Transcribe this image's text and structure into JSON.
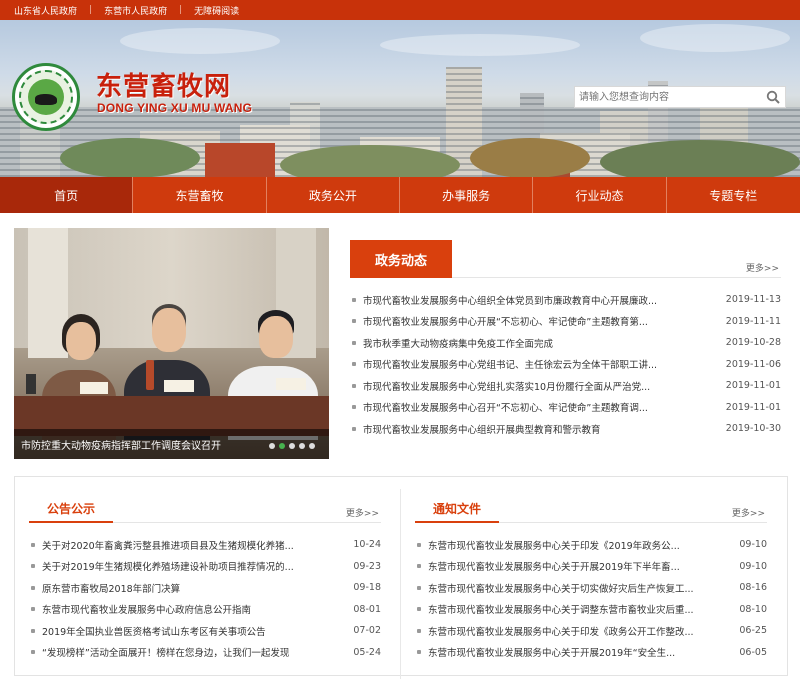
{
  "topbar": {
    "links": [
      "山东省人民政府",
      "东营市人民政府",
      "无障碍阅读"
    ],
    "separator": "|"
  },
  "header": {
    "site_title": "东营畜牧网",
    "site_subtitle": "DONG YING XU MU WANG",
    "search_placeholder": "请输入您想查询内容"
  },
  "nav": {
    "items": [
      "首页",
      "东营畜牧",
      "政务公开",
      "办事服务",
      "行业动态",
      "专题专栏"
    ],
    "active_index": 0
  },
  "slider": {
    "caption": "市防控重大动物疫病指挥部工作调度会议召开",
    "dot_count": 5,
    "active_dot": 1
  },
  "news": {
    "title": "政务动态",
    "more": "更多>>",
    "items": [
      {
        "title": "市现代畜牧业发展服务中心组织全体党员到市廉政教育中心开展廉政...",
        "date": "2019-11-13"
      },
      {
        "title": "市现代畜牧业发展服务中心开展“不忘初心、牢记使命”主题教育第...",
        "date": "2019-11-11"
      },
      {
        "title": "我市秋季重大动物疫病集中免疫工作全面完成",
        "date": "2019-10-28"
      },
      {
        "title": "市现代畜牧业发展服务中心党组书记、主任徐宏云为全体干部职工讲...",
        "date": "2019-11-06"
      },
      {
        "title": "市现代畜牧业发展服务中心党组扎实落实10月份履行全面从严治党...",
        "date": "2019-11-01"
      },
      {
        "title": "市现代畜牧业发展服务中心召开“不忘初心、牢记使命”主题教育调...",
        "date": "2019-11-01"
      },
      {
        "title": "市现代畜牧业发展服务中心组织开展典型教育和警示教育",
        "date": "2019-10-30"
      }
    ]
  },
  "notice": {
    "title": "公告公示",
    "more": "更多>>",
    "items": [
      {
        "title": "关于对2020年畜禽粪污整县推进项目县及生猪规模化养猪...",
        "date": "10-24"
      },
      {
        "title": "关于对2019年生猪规模化养殖场建设补助项目推荐情况的...",
        "date": "09-23"
      },
      {
        "title": "原东营市畜牧局2018年部门决算",
        "date": "09-18"
      },
      {
        "title": "东营市现代畜牧业发展服务中心政府信息公开指南",
        "date": "08-01"
      },
      {
        "title": "2019年全国执业兽医资格考试山东考区有关事项公告",
        "date": "07-02"
      },
      {
        "title": "“发现榜样”活动全面展开！榜样在您身边，让我们一起发现",
        "date": "05-24"
      }
    ]
  },
  "docs": {
    "title": "通知文件",
    "more": "更多>>",
    "items": [
      {
        "title": "东营市现代畜牧业发展服务中心关于印发《2019年政务公...",
        "date": "09-10"
      },
      {
        "title": "东营市现代畜牧业发展服务中心关于开展2019年下半年畜...",
        "date": "09-10"
      },
      {
        "title": "东营市现代畜牧业发展服务中心关于切实做好灾后生产恢复工...",
        "date": "08-16"
      },
      {
        "title": "东营市现代畜牧业发展服务中心关于调整东营市畜牧业灾后重...",
        "date": "08-10"
      },
      {
        "title": "东营市现代畜牧业发展服务中心关于印发《政务公开工作整改...",
        "date": "06-25"
      },
      {
        "title": "东营市现代畜牧业发展服务中心关于开展2019年“安全生...",
        "date": "06-05"
      }
    ]
  },
  "colors": {
    "brand_red": "#cf3a0d",
    "dark_red": "#a8280a",
    "accent": "#d9400d"
  }
}
